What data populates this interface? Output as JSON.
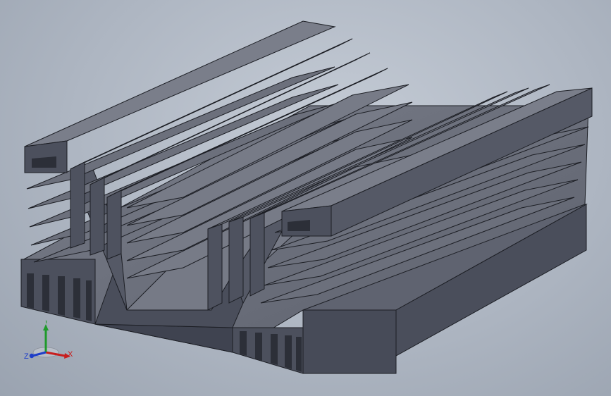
{
  "triad": {
    "x_label": "X",
    "y_label": "Y",
    "z_label": "Z",
    "x_color": "#c81e1e",
    "y_color": "#1e9a2a",
    "z_color": "#1e3ec8"
  },
  "colors": {
    "face_top": "#6a6e7a",
    "face_front": "#4a4e5a",
    "face_side": "#5a5e6a",
    "highlight": "#8a8e9a",
    "edge": "#1c1e24"
  },
  "icons": {
    "triad": "xyz-axis-triad-icon"
  }
}
